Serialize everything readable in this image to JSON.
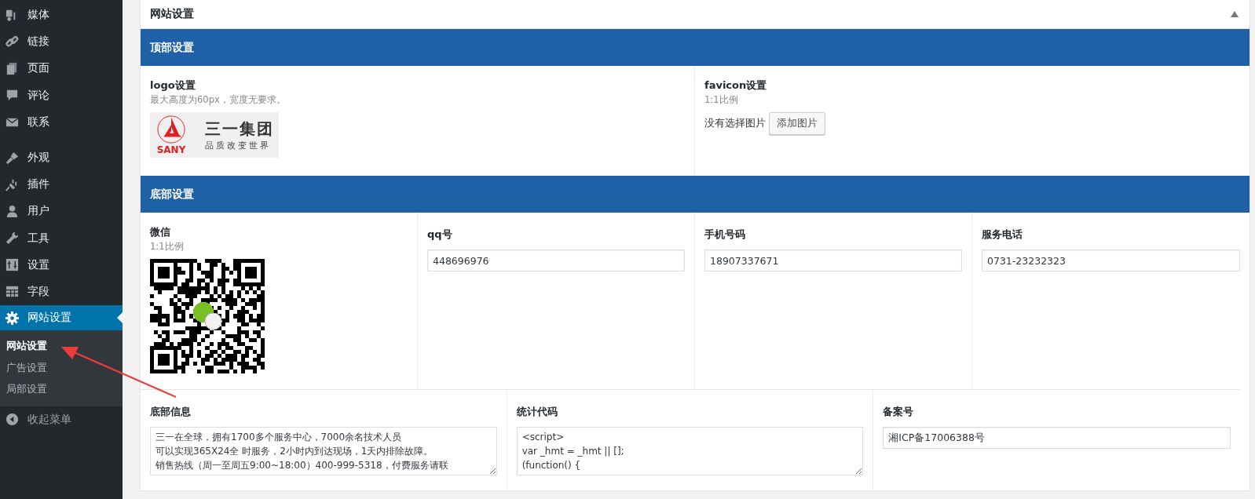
{
  "sidebar": {
    "items": [
      {
        "label": "媒体",
        "kind": "media",
        "selected": false,
        "gap_before": false
      },
      {
        "label": "链接",
        "kind": "link",
        "selected": false,
        "gap_before": false
      },
      {
        "label": "页面",
        "kind": "pages",
        "selected": false,
        "gap_before": false
      },
      {
        "label": "评论",
        "kind": "comment",
        "selected": false,
        "gap_before": false
      },
      {
        "label": "联系",
        "kind": "mail",
        "selected": false,
        "gap_before": false
      },
      {
        "label": "外观",
        "kind": "brush",
        "selected": false,
        "gap_before": true
      },
      {
        "label": "插件",
        "kind": "plug",
        "selected": false,
        "gap_before": false
      },
      {
        "label": "用户",
        "kind": "user",
        "selected": false,
        "gap_before": false
      },
      {
        "label": "工具",
        "kind": "wrench",
        "selected": false,
        "gap_before": false
      },
      {
        "label": "设置",
        "kind": "sliders",
        "selected": false,
        "gap_before": false
      },
      {
        "label": "字段",
        "kind": "table",
        "selected": false,
        "gap_before": false
      },
      {
        "label": "网站设置",
        "kind": "gear",
        "selected": true,
        "gap_before": false,
        "children": [
          {
            "label": "网站设置",
            "selected": true
          },
          {
            "label": "广告设置",
            "selected": false
          },
          {
            "label": "局部设置",
            "selected": false
          }
        ]
      }
    ],
    "collapse": "收起菜单"
  },
  "panel": {
    "title": "网站设置",
    "expanded": true,
    "top_section": {
      "title": "顶部设置",
      "logo": {
        "label": "logo设置",
        "hint": "最大高度为60px，宽度无要求。",
        "image": {
          "mark": "SANY",
          "name": "三一集团",
          "slogan": "品质改变世界"
        }
      },
      "favicon": {
        "label": "favicon设置",
        "hint": "1:1比例",
        "status": "没有选择图片",
        "button": "添加图片"
      }
    },
    "bottom_section": {
      "title": "底部设置",
      "wechat": {
        "label": "微信",
        "hint": "1:1比例"
      },
      "fields": [
        {
          "label": "qq号",
          "value": "448696976"
        },
        {
          "label": "手机号码",
          "value": "18907337671"
        },
        {
          "label": "服务电话",
          "value": "0731-23232323"
        }
      ],
      "footer_info": {
        "label": "底部信息",
        "lines": [
          "三一在全球，拥有1700多个服务中心，7000余名技术人员",
          "可以实现365X24全 时服务，2小时内到达现场，1天内排除故障。",
          "销售热线（周一至周五9:00~18:00）400-999-5318，付费服务请联"
        ]
      },
      "stats_code": {
        "label": "统计代码",
        "lines": [
          "<script>",
          "var _hmt = _hmt || [];",
          "(function() {"
        ]
      },
      "icp": {
        "label": "备案号",
        "value": "湘ICP备17006388号"
      }
    }
  }
}
